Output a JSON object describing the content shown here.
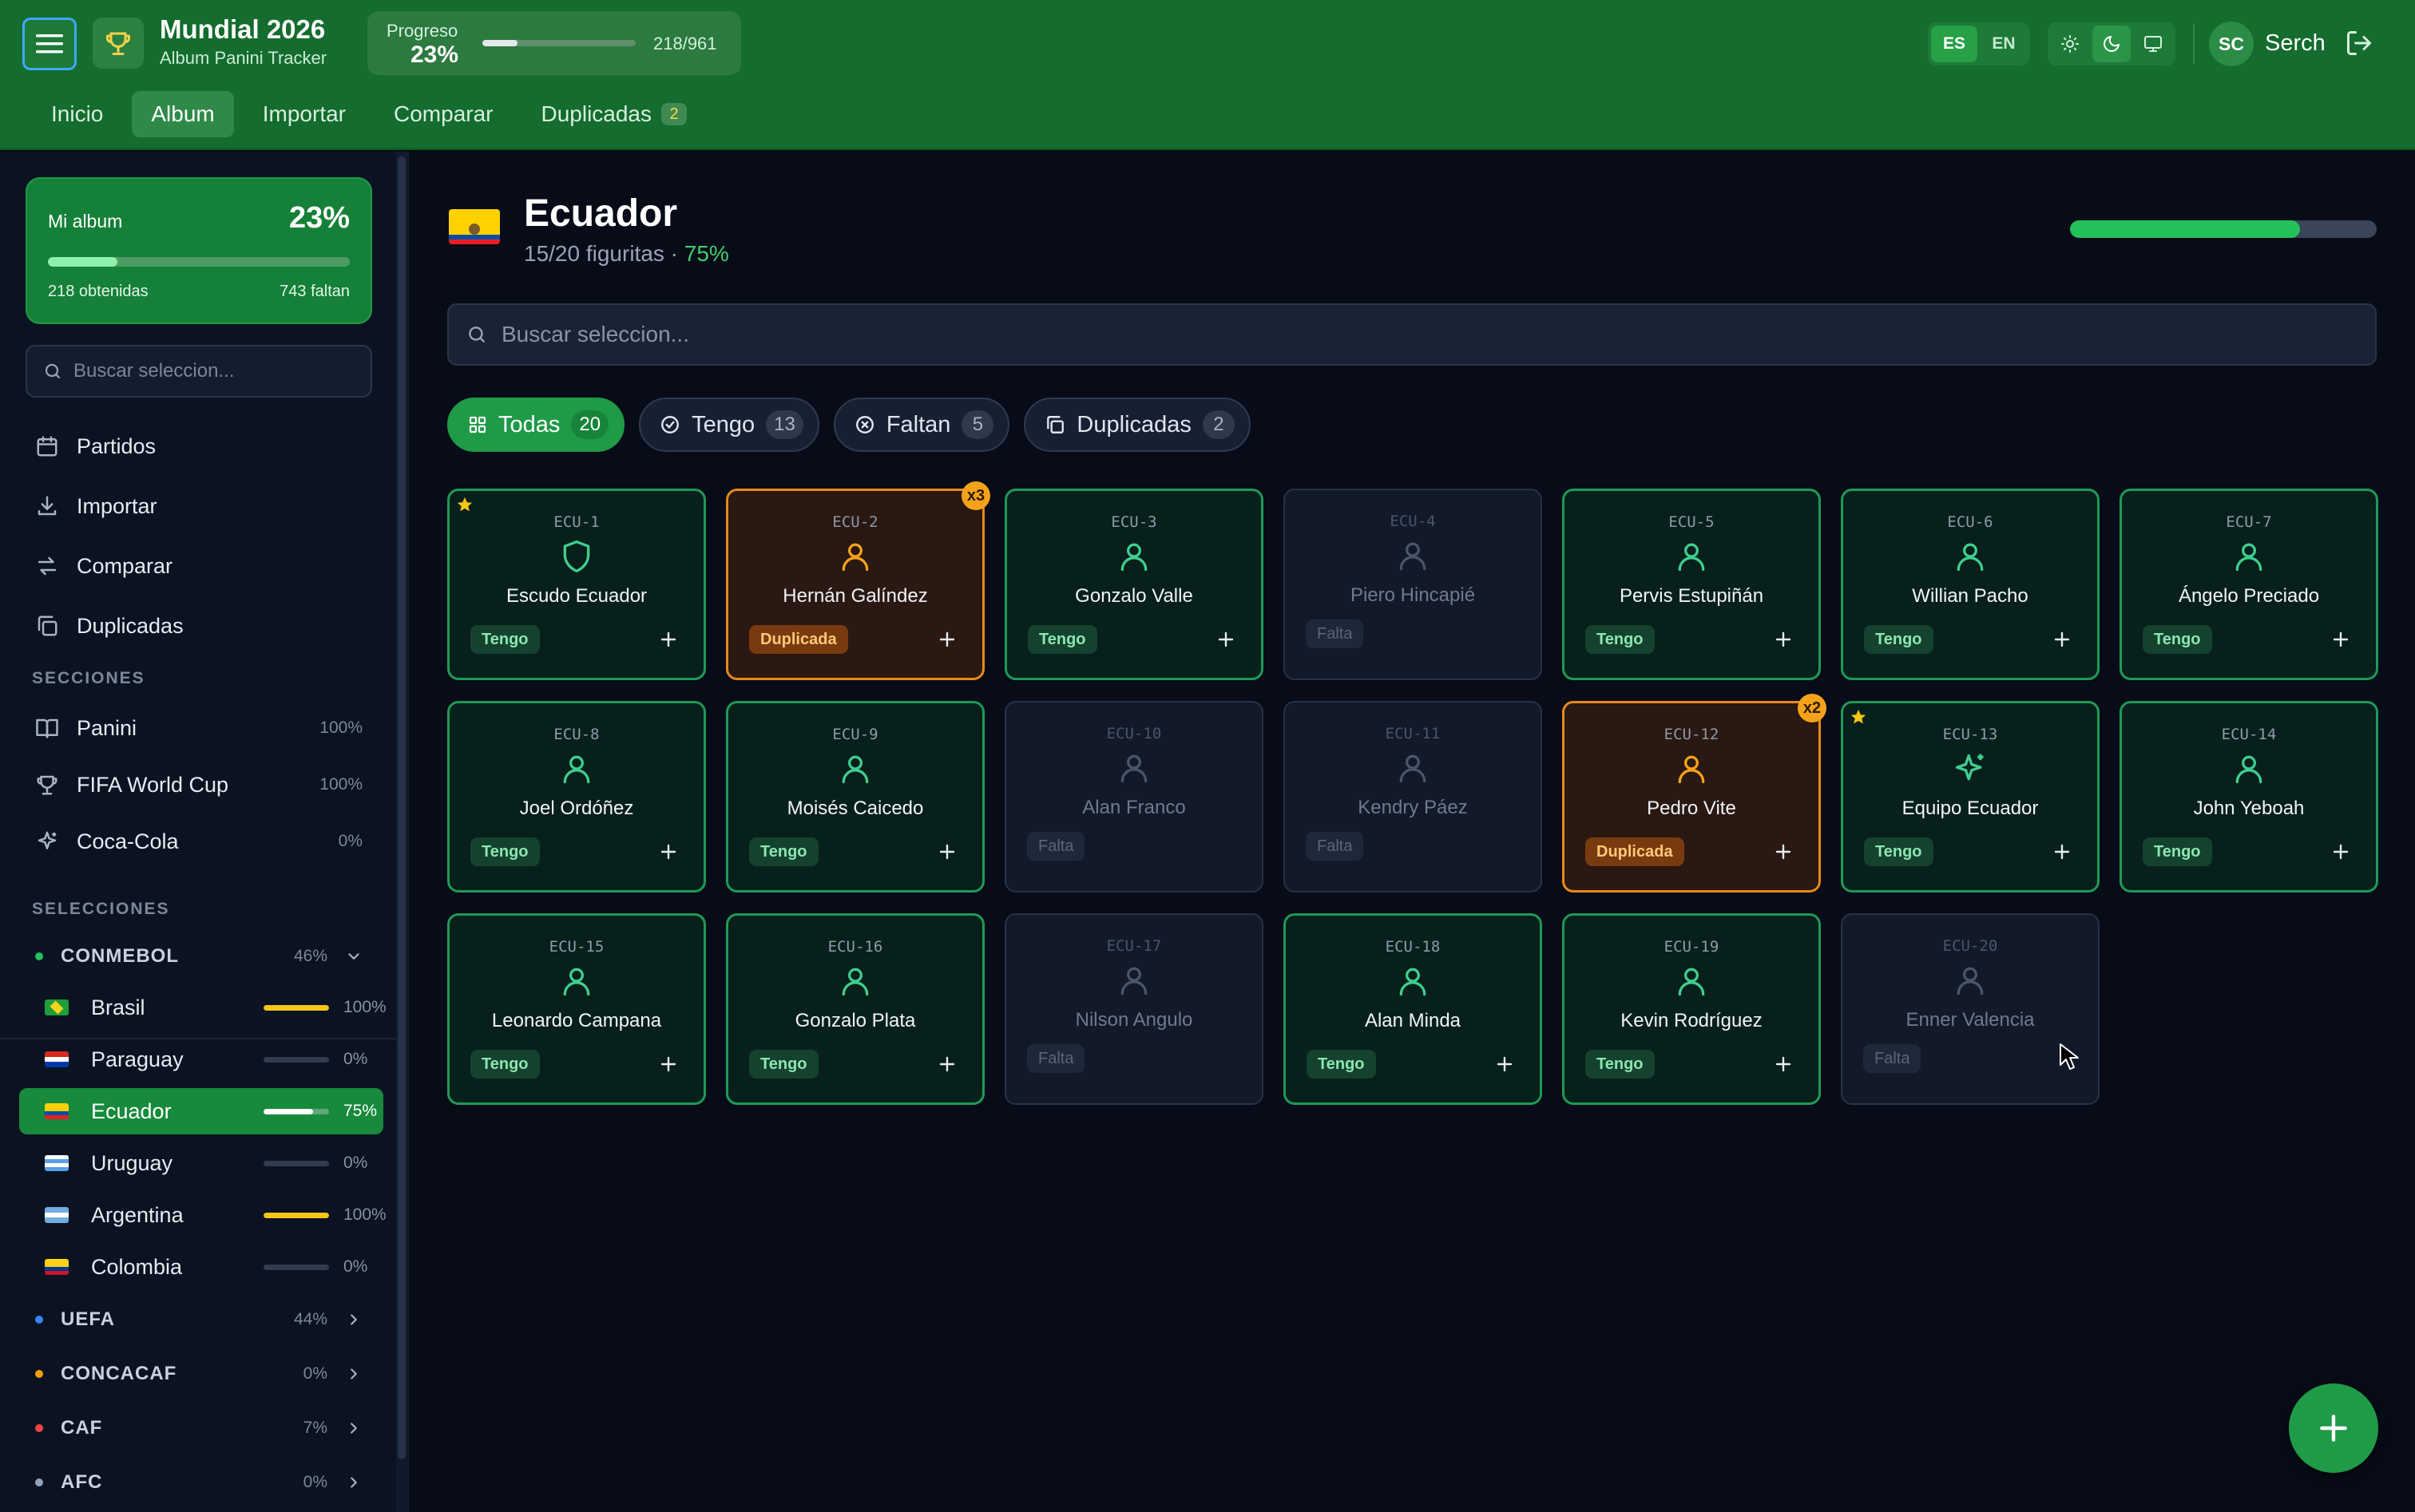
{
  "header": {
    "title": "Mundial 2026",
    "subtitle": "Album Panini Tracker",
    "progress_label": "Progreso",
    "progress_pct": "23%",
    "progress_value": 0.23,
    "progress_count": "218/961",
    "lang": [
      "ES",
      "EN"
    ],
    "user_initials": "SC",
    "user_name": "Serch"
  },
  "nav": {
    "tabs": [
      "Inicio",
      "Album",
      "Importar",
      "Comparar",
      "Duplicadas"
    ],
    "duplicates_badge": "2"
  },
  "sidebar": {
    "album": {
      "label": "Mi album",
      "pct": "23%",
      "value": 0.23,
      "got": "218 obtenidas",
      "missing": "743 faltan"
    },
    "search_placeholder": "Buscar seleccion...",
    "links": [
      "Partidos",
      "Importar",
      "Comparar",
      "Duplicadas"
    ],
    "sections_title": "SECCIONES",
    "sections": [
      {
        "label": "Panini",
        "pct": "100%"
      },
      {
        "label": "FIFA World Cup",
        "pct": "100%"
      },
      {
        "label": "Coca-Cola",
        "pct": "0%"
      }
    ],
    "selections_title": "SELECCIONES",
    "conf_conmebol": {
      "label": "CONMEBOL",
      "pct": "46%",
      "color": "#22c15a"
    },
    "teams": [
      {
        "label": "Brasil",
        "pct": "100%",
        "value": 1.0
      },
      {
        "label": "Paraguay",
        "pct": "0%",
        "value": 0
      },
      {
        "label": "Ecuador",
        "pct": "75%",
        "value": 0.75
      },
      {
        "label": "Uruguay",
        "pct": "0%",
        "value": 0
      },
      {
        "label": "Argentina",
        "pct": "100%",
        "value": 1.0
      },
      {
        "label": "Colombia",
        "pct": "0%",
        "value": 0
      }
    ],
    "confs": [
      {
        "label": "UEFA",
        "pct": "44%",
        "color": "#3b82f6"
      },
      {
        "label": "CONCACAF",
        "pct": "0%",
        "color": "#f59e0b"
      },
      {
        "label": "CAF",
        "pct": "7%",
        "color": "#ef4444"
      },
      {
        "label": "AFC",
        "pct": "0%",
        "color": "#94a3b8"
      }
    ]
  },
  "team": {
    "name": "Ecuador",
    "summary": "15/20 figuritas · ",
    "pct": "75%",
    "value": 0.75,
    "search_placeholder": "Buscar seleccion..."
  },
  "filters": [
    {
      "label": "Todas",
      "count": "20"
    },
    {
      "label": "Tengo",
      "count": "13"
    },
    {
      "label": "Faltan",
      "count": "5"
    },
    {
      "label": "Duplicadas",
      "count": "2"
    }
  ],
  "status_labels": {
    "have": "Tengo",
    "dup": "Duplicada",
    "missing": "Falta"
  },
  "stickers": [
    {
      "code": "ECU-1",
      "name": "Escudo Ecuador",
      "status": "have",
      "icon": "shield-icon",
      "star": true
    },
    {
      "code": "ECU-2",
      "name": "Hernán Galíndez",
      "status": "dup",
      "icon": "person-icon",
      "mult": "x3"
    },
    {
      "code": "ECU-3",
      "name": "Gonzalo Valle",
      "status": "have",
      "icon": "person-icon"
    },
    {
      "code": "ECU-4",
      "name": "Piero Hincapié",
      "status": "missing",
      "icon": "person-icon"
    },
    {
      "code": "ECU-5",
      "name": "Pervis Estupiñán",
      "status": "have",
      "icon": "person-icon"
    },
    {
      "code": "ECU-6",
      "name": "Willian Pacho",
      "status": "have",
      "icon": "person-icon"
    },
    {
      "code": "ECU-7",
      "name": "Ángelo Preciado",
      "status": "have",
      "icon": "person-icon"
    },
    {
      "code": "ECU-8",
      "name": "Joel Ordóñez",
      "status": "have",
      "icon": "person-icon"
    },
    {
      "code": "ECU-9",
      "name": "Moisés Caicedo",
      "status": "have",
      "icon": "person-icon"
    },
    {
      "code": "ECU-10",
      "name": "Alan Franco",
      "status": "missing",
      "icon": "person-icon"
    },
    {
      "code": "ECU-11",
      "name": "Kendry Páez",
      "status": "missing",
      "icon": "person-icon"
    },
    {
      "code": "ECU-12",
      "name": "Pedro Vite",
      "status": "dup",
      "icon": "person-icon",
      "mult": "x2"
    },
    {
      "code": "ECU-13",
      "name": "Equipo Ecuador",
      "status": "have",
      "icon": "sparkle-icon",
      "star": true
    },
    {
      "code": "ECU-14",
      "name": "John Yeboah",
      "status": "have",
      "icon": "person-icon"
    },
    {
      "code": "ECU-15",
      "name": "Leonardo Campana",
      "status": "have",
      "icon": "person-icon"
    },
    {
      "code": "ECU-16",
      "name": "Gonzalo Plata",
      "status": "have",
      "icon": "person-icon"
    },
    {
      "code": "ECU-17",
      "name": "Nilson Angulo",
      "status": "missing",
      "icon": "person-icon"
    },
    {
      "code": "ECU-18",
      "name": "Alan Minda",
      "status": "have",
      "icon": "person-icon"
    },
    {
      "code": "ECU-19",
      "name": "Kevin Rodríguez",
      "status": "have",
      "icon": "person-icon"
    },
    {
      "code": "ECU-20",
      "name": "Enner Valencia",
      "status": "missing",
      "icon": "person-icon"
    }
  ],
  "colors": {
    "have": "#3fcf8e",
    "dup": "#f5a21b",
    "missing": "#4a5568",
    "accent": "#1f9a47"
  }
}
